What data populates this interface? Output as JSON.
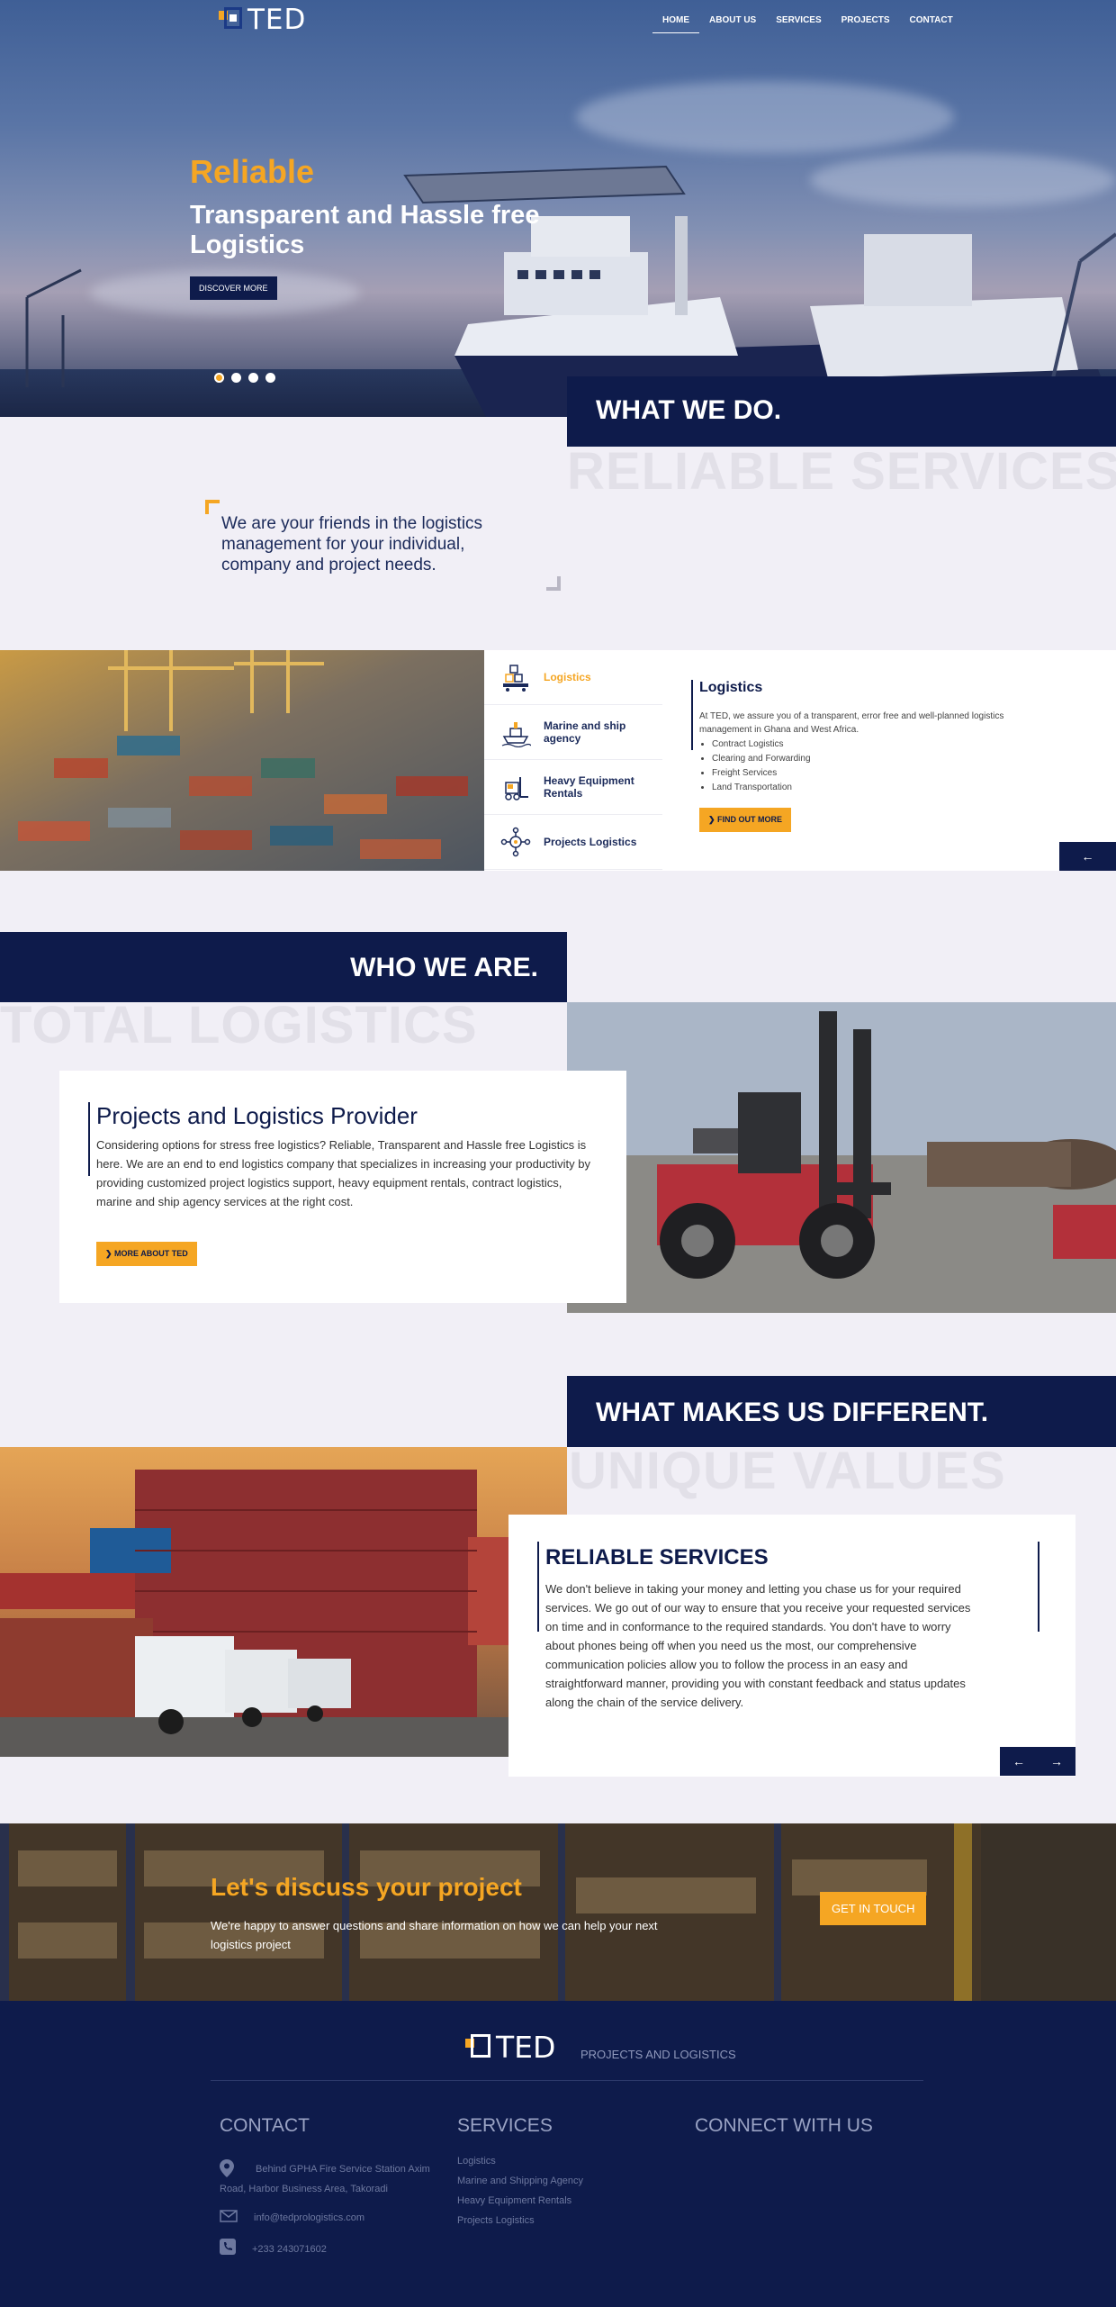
{
  "brand": {
    "logo_text": "TED",
    "navy": "#0e1b4b",
    "accent": "#f5a623"
  },
  "nav": [
    {
      "label": "HOME",
      "active": true
    },
    {
      "label": "ABOUT US"
    },
    {
      "label": "SERVICES"
    },
    {
      "label": "PROJECTS"
    },
    {
      "label": "CONTACT"
    }
  ],
  "hero": {
    "kicker": "Reliable",
    "title": "Transparent and Hassle free Logistics",
    "button": "DISCOVER MORE",
    "slides": 4,
    "active_slide": 1
  },
  "what_we_do": {
    "heading": "WHAT WE DO.",
    "ghost": "RELIABLE SERVICES",
    "quote": "We are your friends in the logistics management for your individual, company and project needs.",
    "services": [
      {
        "label": "Logistics",
        "icon": "forklift-boxes-icon",
        "active": true
      },
      {
        "label": "Marine and ship agency",
        "icon": "ship-icon"
      },
      {
        "label": "Heavy Equipment Rentals",
        "icon": "forklift-icon"
      },
      {
        "label": "Projects Logistics",
        "icon": "gear-network-icon"
      }
    ],
    "panel": {
      "title": "Logistics",
      "text": "At TED, we assure you of a transparent, error free and well-planned logistics management in Ghana and West Africa.",
      "bullets": [
        "Contract Logistics",
        "Clearing and Forwarding",
        "Freight Services",
        "Land Transportation"
      ],
      "button": "FIND OUT MORE",
      "prev": "←"
    }
  },
  "who_we_are": {
    "heading": "WHO WE ARE.",
    "ghost": "TOTAL LOGISTICS",
    "title": "Projects and Logistics Provider",
    "text": "Considering options for stress free logistics? Reliable, Transparent and Hassle free Logistics is here. We are an end to end logistics company that specializes in increasing your productivity by providing customized project logistics support, heavy equipment rentals, contract logistics, marine and ship agency services at the right cost.",
    "button": "MORE ABOUT TED"
  },
  "different": {
    "heading": "WHAT MAKES US DIFFERENT.",
    "ghost": "UNIQUE VALUES",
    "title": "RELIABLE SERVICES",
    "text": "We don't believe in taking your money and letting you chase us for your required services. We go out of our way to ensure that you receive your requested services on time and in conformance to the required standards. You don't have to worry about phones being off when you need us the most, our comprehensive communication policies allow you to follow the process in an easy and straightforward manner, providing you with constant feedback and status updates along the chain of the service delivery.",
    "prev": "←",
    "next": "→"
  },
  "cta": {
    "title": "Let's discuss your project",
    "text": "We're happy to answer questions and share information on how we can help your next logistics project",
    "button": "GET IN TOUCH"
  },
  "footer": {
    "tagline": "PROJECTS AND LOGISTICS",
    "contact_title": "CONTACT",
    "address": "Behind GPHA Fire Service Station Axim Road, Harbor Business Area, Takoradi",
    "email": "info@tedprologistics.com",
    "phone": "+233 243071602",
    "services_title": "SERVICES",
    "services": [
      "Logistics",
      "Marine and Shipping Agency",
      "Heavy Equipment Rentals",
      "Projects Logistics"
    ],
    "connect_title": "CONNECT WITH US"
  }
}
